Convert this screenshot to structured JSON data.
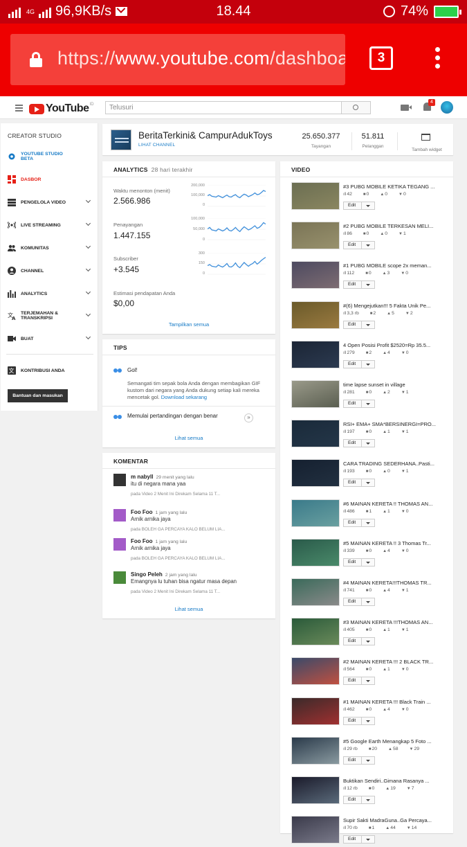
{
  "status_bar": {
    "network": "4G",
    "speed": "96,9KB/s",
    "time": "18.44",
    "battery": "74%"
  },
  "browser": {
    "url_prefix": "https://",
    "url_domain": "www.youtube.com",
    "url_rest": "/dashboard",
    "tab_count": "3"
  },
  "yt_header": {
    "logo_text": "YouTube",
    "logo_region": "ID",
    "search_placeholder": "Telusuri",
    "notification_count": "4"
  },
  "sidebar": {
    "title": "CREATOR STUDIO",
    "items": [
      {
        "label": "YOUTUBE STUDIO BETA",
        "icon": "gear-icon",
        "color": "#167ac6"
      },
      {
        "label": "DASBOR",
        "icon": "dashboard-icon",
        "color": "#e62117"
      },
      {
        "label": "PENGELOLA VIDEO",
        "icon": "video-manager-icon"
      },
      {
        "label": "LIVE STREAMING",
        "icon": "live-icon"
      },
      {
        "label": "KOMUNITAS",
        "icon": "community-icon"
      },
      {
        "label": "CHANNEL",
        "icon": "channel-icon"
      },
      {
        "label": "ANALYTICS",
        "icon": "analytics-icon"
      },
      {
        "label": "TERJEMAHAN & TRANSKRIPSI",
        "icon": "translate-icon"
      },
      {
        "label": "BUAT",
        "icon": "create-icon"
      },
      {
        "label": "KONTRIBUSI ANDA",
        "icon": "contribute-icon"
      }
    ],
    "help_button": "Bantuan dan masukan"
  },
  "channel": {
    "name": "BeritaTerkini& CampurAdukToys",
    "link": "LIHAT CHANNEL",
    "views_value": "25.650.377",
    "views_label": "Tayangan",
    "subs_value": "51.811",
    "subs_label": "Pelanggan",
    "widget_label": "Tambah widget"
  },
  "analytics": {
    "title": "ANALYTICS",
    "subtitle": "28 hari terakhir",
    "metrics": [
      {
        "label": "Waktu menonton (menit)",
        "value": "2.566.986",
        "ticks": [
          "200,000",
          "100,000",
          "0"
        ],
        "trend": [
          0.55,
          0.6,
          0.52,
          0.5,
          0.48,
          0.55,
          0.5,
          0.45,
          0.52,
          0.58,
          0.5,
          0.48,
          0.55,
          0.6,
          0.5,
          0.45,
          0.55,
          0.62,
          0.58,
          0.5,
          0.55,
          0.6,
          0.68,
          0.6,
          0.62,
          0.7,
          0.8,
          0.75
        ]
      },
      {
        "label": "Penayangan",
        "value": "1.447.155",
        "ticks": [
          "100,000",
          "50,000",
          "0"
        ],
        "trend": [
          0.55,
          0.62,
          0.5,
          0.48,
          0.45,
          0.55,
          0.5,
          0.45,
          0.5,
          0.6,
          0.48,
          0.45,
          0.52,
          0.62,
          0.5,
          0.42,
          0.55,
          0.65,
          0.58,
          0.5,
          0.55,
          0.62,
          0.7,
          0.58,
          0.62,
          0.72,
          0.85,
          0.78
        ]
      },
      {
        "label": "Subscriber",
        "value": "+3.545",
        "ticks": [
          "300",
          "150",
          "0"
        ],
        "trend": [
          0.45,
          0.5,
          0.42,
          0.4,
          0.38,
          0.48,
          0.42,
          0.38,
          0.45,
          0.55,
          0.4,
          0.38,
          0.45,
          0.58,
          0.42,
          0.35,
          0.48,
          0.6,
          0.5,
          0.42,
          0.5,
          0.55,
          0.65,
          0.52,
          0.6,
          0.7,
          0.78,
          0.85
        ]
      }
    ],
    "revenue_label": "Estimasi pendapatan Anda",
    "revenue_value": "$0,00",
    "more_link": "Tampilkan semua",
    "line_color": "#3f8fdb"
  },
  "tips": {
    "title": "TIPS",
    "item1_title": "Gol!",
    "item1_body": "Semangati tim sepak bola Anda dengan membagikan GIF kustom dari negara yang Anda dukung setiap kali mereka mencetak gol.",
    "item1_link": "Download sekarang",
    "item2_title": "Memulai pertandingan dengan benar",
    "more_link": "Lihat semua"
  },
  "comments": {
    "title": "KOMENTAR",
    "items": [
      {
        "name": "m nabyll",
        "time": "29 menit yang lalu",
        "text": "itu di negara mana yaa",
        "on": "pada Video 2 Menit Ini Direkam Selama 11 T...",
        "avatar_color": "#333333"
      },
      {
        "name": "Foo Foo",
        "time": "1 jam yang lalu",
        "text": "Arnik arnika jaya",
        "on": "pada BOLEH GA PERCAYA KALO BELUM LIA...",
        "avatar_color": "#a35bc8"
      },
      {
        "name": "Foo Foo",
        "time": "1 jam yang lalu",
        "text": "Arnik arnika jaya",
        "on": "pada BOLEH GA PERCAYA KALO BELUM LIA...",
        "avatar_color": "#a35bc8"
      },
      {
        "name": "Singo Peleh",
        "time": "2 jam yang lalu",
        "text": "Emangnya lu tuhan bisa ngatur masa depan",
        "on": "pada Video 2 Menit Ini Direkam Selama 11 T...",
        "avatar_color": "#4a8a3a"
      }
    ],
    "more_link": "Lihat semua"
  },
  "videos": {
    "title": "VIDEO",
    "edit_label": "Edit",
    "items": [
      {
        "title": "#3 PUBG MOBILE KETIKA TEGANG ...",
        "views": "42",
        "comments": "0",
        "likes": "0",
        "dislikes": "0",
        "thumb": [
          "#6b6e52",
          "#8a8660"
        ]
      },
      {
        "title": "#2 PUBG MOBILE TERKESAN MELI...",
        "views": "86",
        "comments": "0",
        "likes": "0",
        "dislikes": "1",
        "thumb": [
          "#7a7456",
          "#98916d"
        ]
      },
      {
        "title": "#1 PUBG MOBILE scope 2x meman...",
        "views": "112",
        "comments": "0",
        "likes": "3",
        "dislikes": "0",
        "thumb": [
          "#4d4a60",
          "#7d6c72"
        ]
      },
      {
        "title": "#(6) Mengejutkan!!! 5 Fakta Unik Pe...",
        "views": "3,3 rb",
        "comments": "2",
        "likes": "5",
        "dislikes": "2",
        "thumb": [
          "#6a5a2a",
          "#9a7a40"
        ]
      },
      {
        "title": "4 Open Posisi Profit $2520=Rp 35.5...",
        "views": "279",
        "comments": "2",
        "likes": "4",
        "dislikes": "0",
        "thumb": [
          "#1b2535",
          "#2c3a50"
        ]
      },
      {
        "title": "time lapse sunset in village",
        "views": "281",
        "comments": "0",
        "likes": "2",
        "dislikes": "1",
        "thumb": [
          "#9a9a8a",
          "#5a5e50"
        ]
      },
      {
        "title": "RSI+ EMA+ SMA*BERSINERGI=PRO...",
        "views": "197",
        "comments": "0",
        "likes": "1",
        "dislikes": "1",
        "thumb": [
          "#1a2a3a",
          "#243648"
        ]
      },
      {
        "title": "CARA TRADING SEDERHANA..Pasti...",
        "views": "193",
        "comments": "0",
        "likes": "0",
        "dislikes": "1",
        "thumb": [
          "#152030",
          "#223040"
        ]
      },
      {
        "title": "#6 MAINAN KERETA !! THOMAS AN...",
        "views": "486",
        "comments": "1",
        "likes": "1",
        "dislikes": "0",
        "thumb": [
          "#3a7a8a",
          "#6aa0a0"
        ]
      },
      {
        "title": "#5 MAINAN KERETA !! 3 Thomas Tr...",
        "views": "339",
        "comments": "0",
        "likes": "4",
        "dislikes": "0",
        "thumb": [
          "#2a5a4a",
          "#4a8a6a"
        ]
      },
      {
        "title": "#4 MAINAN KERETA!!!THOMAS TR...",
        "views": "741",
        "comments": "0",
        "likes": "4",
        "dislikes": "1",
        "thumb": [
          "#3a6a5a",
          "#8a8a8a"
        ]
      },
      {
        "title": "#3 MAINAN KERETA !!!THOMAS AN...",
        "views": "405",
        "comments": "0",
        "likes": "1",
        "dislikes": "1",
        "thumb": [
          "#2a5a3a",
          "#6a8a5a"
        ]
      },
      {
        "title": "#2 MAINAN KERETA !!! 2 BLACK TR...",
        "views": "564",
        "comments": "0",
        "likes": "1",
        "dislikes": "0",
        "thumb": [
          "#3a4a6a",
          "#c05040"
        ]
      },
      {
        "title": "#1 MAINAN KERETA !!! Black Train ...",
        "views": "462",
        "comments": "0",
        "likes": "4",
        "dislikes": "0",
        "thumb": [
          "#3a2a2a",
          "#a03030"
        ]
      },
      {
        "title": "#5 Google Earth Menangkap 5 Foto ...",
        "views": "29 rb",
        "comments": "20",
        "likes": "58",
        "dislikes": "29",
        "thumb": [
          "#2a3a4a",
          "#8a9aa0"
        ]
      },
      {
        "title": "Buktikan Sendiri..Gimana Rasanya ...",
        "views": "12 rb",
        "comments": "0",
        "likes": "19",
        "dislikes": "7",
        "thumb": [
          "#1a1a2a",
          "#5a6a7a"
        ]
      },
      {
        "title": "Supir Sakti MadraGuna..Ga Percaya...",
        "views": "70 rb",
        "comments": "1",
        "likes": "44",
        "dislikes": "14",
        "thumb": [
          "#3a3a4a",
          "#7a7a8a"
        ]
      }
    ]
  }
}
